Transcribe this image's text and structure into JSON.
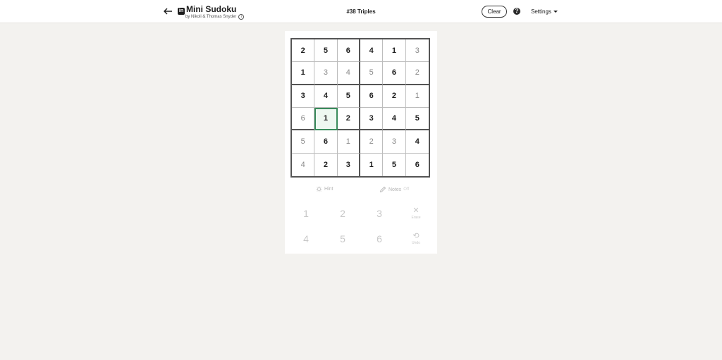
{
  "header": {
    "title": "Mini Sudoku",
    "logo_text": "in",
    "byline": "by Nikoli & Thomas Snyder",
    "puzzle_name": "#38 Triples",
    "clear_label": "Clear",
    "help_label": "?",
    "settings_label": "Settings"
  },
  "grid": [
    [
      {
        "v": "2",
        "t": "given"
      },
      {
        "v": "5",
        "t": "given"
      },
      {
        "v": "6",
        "t": "given"
      },
      {
        "v": "4",
        "t": "given"
      },
      {
        "v": "1",
        "t": "given"
      },
      {
        "v": "3",
        "t": "user"
      }
    ],
    [
      {
        "v": "1",
        "t": "given"
      },
      {
        "v": "3",
        "t": "user"
      },
      {
        "v": "4",
        "t": "user"
      },
      {
        "v": "5",
        "t": "user"
      },
      {
        "v": "6",
        "t": "given"
      },
      {
        "v": "2",
        "t": "user"
      }
    ],
    [
      {
        "v": "3",
        "t": "given"
      },
      {
        "v": "4",
        "t": "given"
      },
      {
        "v": "5",
        "t": "given"
      },
      {
        "v": "6",
        "t": "given"
      },
      {
        "v": "2",
        "t": "given"
      },
      {
        "v": "1",
        "t": "user"
      }
    ],
    [
      {
        "v": "6",
        "t": "user"
      },
      {
        "v": "1",
        "t": "given"
      },
      {
        "v": "2",
        "t": "given"
      },
      {
        "v": "3",
        "t": "given"
      },
      {
        "v": "4",
        "t": "given"
      },
      {
        "v": "5",
        "t": "given"
      }
    ],
    [
      {
        "v": "5",
        "t": "user"
      },
      {
        "v": "6",
        "t": "given"
      },
      {
        "v": "1",
        "t": "user"
      },
      {
        "v": "2",
        "t": "user"
      },
      {
        "v": "3",
        "t": "user"
      },
      {
        "v": "4",
        "t": "given"
      }
    ],
    [
      {
        "v": "4",
        "t": "user"
      },
      {
        "v": "2",
        "t": "given"
      },
      {
        "v": "3",
        "t": "given"
      },
      {
        "v": "1",
        "t": "given"
      },
      {
        "v": "5",
        "t": "given"
      },
      {
        "v": "6",
        "t": "given"
      }
    ]
  ],
  "selected_cell": {
    "row": 4,
    "col": 2
  },
  "tools": {
    "hint_label": "Hint",
    "notes_label": "Notes",
    "notes_state": "Off"
  },
  "keypad": {
    "digits": [
      "1",
      "2",
      "3",
      "4",
      "5",
      "6"
    ],
    "erase_label": "Erase",
    "undo_label": "Undo"
  },
  "colors": {
    "background": "#f3f2ef",
    "selected_border": "#3a8c5c",
    "selected_fill": "#eef8f1"
  },
  "icons": {
    "back": "arrow-left-icon",
    "hint": "lightbulb-icon",
    "notes": "pencil-icon",
    "erase": "x-icon",
    "undo": "undo-icon"
  }
}
